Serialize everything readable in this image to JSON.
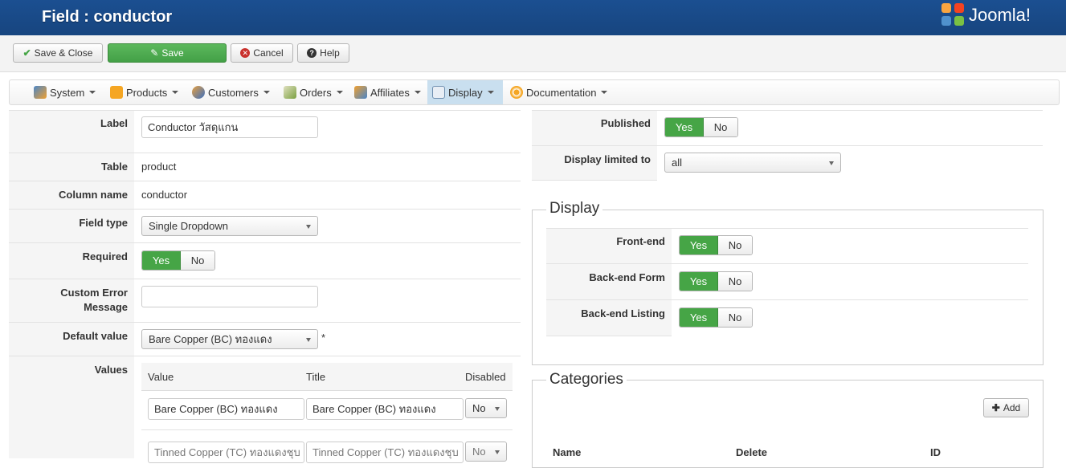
{
  "header": {
    "title": "Field : conductor",
    "logo_text": "Joomla!"
  },
  "toolbar": {
    "save_close": "Save & Close",
    "save": "Save",
    "cancel": "Cancel",
    "help": "Help"
  },
  "menu": [
    {
      "label": "System",
      "icon": "tools-icon"
    },
    {
      "label": "Products",
      "icon": "products-icon"
    },
    {
      "label": "Customers",
      "icon": "customers-icon"
    },
    {
      "label": "Orders",
      "icon": "orders-icon"
    },
    {
      "label": "Affiliates",
      "icon": "affiliates-icon"
    },
    {
      "label": "Display",
      "icon": "display-icon"
    },
    {
      "label": "Documentation",
      "icon": "documentation-icon"
    }
  ],
  "form": {
    "label_label": "Label",
    "label_value": "Conductor วัสดุแกน",
    "table_label": "Table",
    "table_value": "product",
    "column_label": "Column name",
    "column_value": "conductor",
    "fieldtype_label": "Field type",
    "fieldtype_value": "Single Dropdown",
    "required_label": "Required",
    "custom_error_label_1": "Custom Error",
    "custom_error_label_2": "Message",
    "custom_error_value": "",
    "default_label": "Default value",
    "default_value": "Bare Copper (BC) ทองแดง",
    "default_marker": "*",
    "values_label": "Values",
    "values_headers": {
      "value": "Value",
      "title": "Title",
      "disabled": "Disabled"
    },
    "values_rows": [
      {
        "value": "Bare Copper (BC) ทองแดง",
        "title": "Bare Copper (BC) ทองแดง",
        "disabled": "No"
      },
      {
        "value": "Tinned Copper (TC) ทองแดงชุบ",
        "title": "Tinned Copper (TC) ทองแดงชุบ",
        "disabled": "No"
      }
    ]
  },
  "right": {
    "published_label": "Published",
    "display_limited_label": "Display limited to",
    "display_limited_value": "all",
    "display_legend": "Display",
    "frontend_label": "Front-end",
    "backend_form_label": "Back-end Form",
    "backend_listing_label": "Back-end Listing",
    "categories_legend": "Categories",
    "add_label": "Add",
    "cat_headers": {
      "name": "Name",
      "delete": "Delete",
      "id": "ID"
    }
  },
  "yes": "Yes",
  "no": "No",
  "colors": {
    "header": "#1b4f91",
    "green": "#46a546",
    "active_menu": "#c9dfef"
  }
}
